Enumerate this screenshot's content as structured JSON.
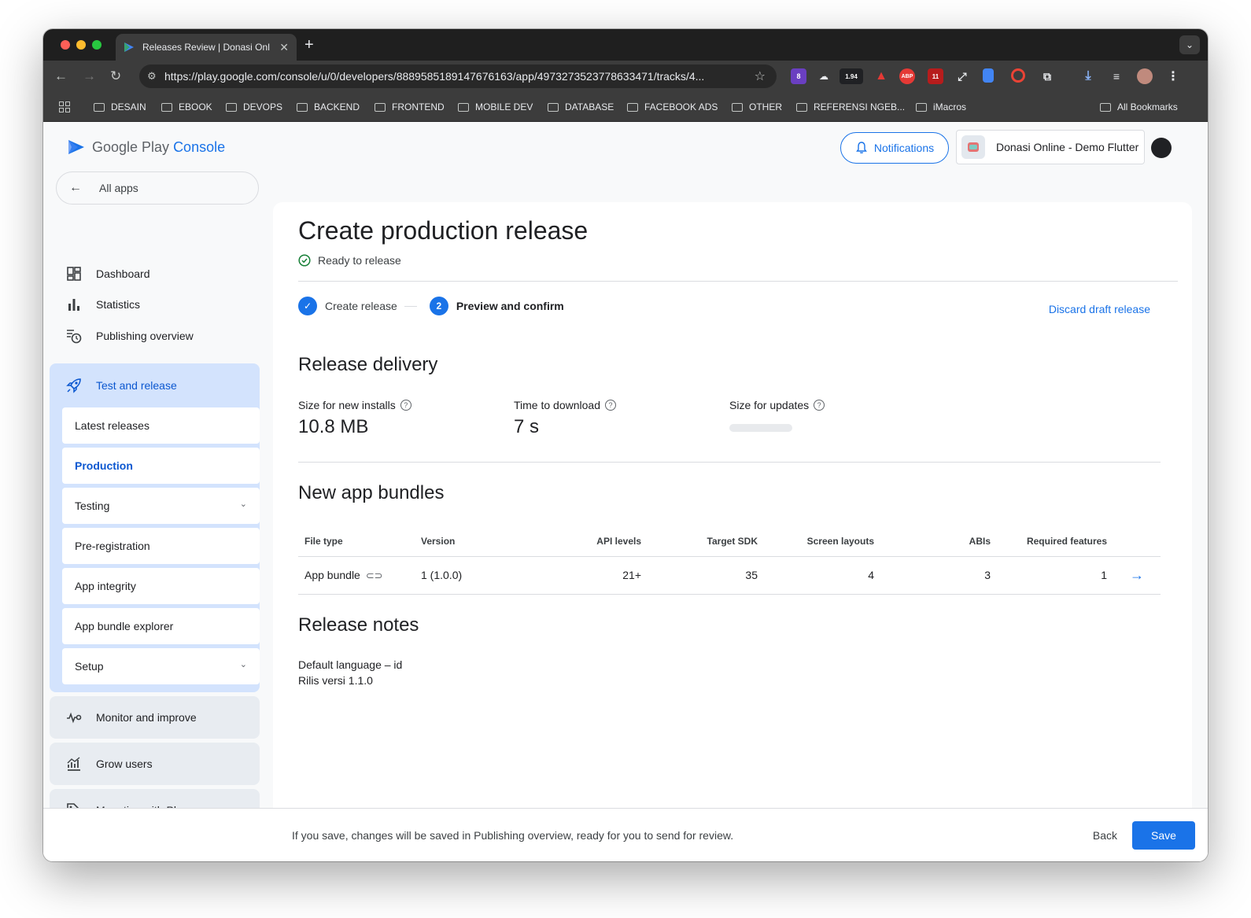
{
  "browser": {
    "tab_title": "Releases Review | Donasi Onl",
    "url": "https://play.google.com/console/u/0/developers/8889585189147676163/app/4973273523778633471/tracks/4...",
    "ext_badges": {
      "pink": "8",
      "speed": "1.94",
      "abp": "ABP",
      "red": "11"
    },
    "bookmarks": [
      "DESAIN",
      "EBOOK",
      "DEVOPS",
      "BACKEND",
      "FRONTEND",
      "MOBILE DEV",
      "DATABASE",
      "FACEBOOK ADS",
      "OTHER",
      "REFERENSI NGEB...",
      "iMacros"
    ],
    "all_bookmarks": "All Bookmarks"
  },
  "header": {
    "logo_google_play": "Google Play",
    "logo_console": "Console",
    "notifications": "Notifications",
    "app_name": "Donasi Online - Demo Flutter"
  },
  "sidebar": {
    "all_apps": "All apps",
    "dashboard": "Dashboard",
    "statistics": "Statistics",
    "publishing_overview": "Publishing overview",
    "test_and_release": "Test and release",
    "sub_items": [
      "Latest releases",
      "Production",
      "Testing",
      "Pre-registration",
      "App integrity",
      "App bundle explorer",
      "Setup"
    ],
    "monitor": "Monitor and improve",
    "grow": "Grow users",
    "monetise": "Monetise with Play"
  },
  "main": {
    "title": "Create production release",
    "status": "Ready to release",
    "steps": {
      "step1": "Create release",
      "step2_num": "2",
      "step2": "Preview and confirm"
    },
    "discard": "Discard draft release",
    "delivery": {
      "heading": "Release delivery",
      "size_label": "Size for new installs",
      "size_value": "10.8 MB",
      "time_label": "Time to download",
      "time_value": "7 s",
      "updates_label": "Size for updates"
    },
    "bundles": {
      "heading": "New app bundles",
      "columns": [
        "File type",
        "Version",
        "API levels",
        "Target SDK",
        "Screen layouts",
        "ABIs",
        "Required features"
      ],
      "row": {
        "file_type": "App bundle",
        "version": "1 (1.0.0)",
        "api": "21+",
        "target": "35",
        "screens": "4",
        "abis": "3",
        "features": "1"
      }
    },
    "notes": {
      "heading": "Release notes",
      "language": "Default language – id",
      "text": "Rilis versi 1.1.0"
    }
  },
  "footer": {
    "message": "If you save, changes will be saved in Publishing overview, ready for you to send for review.",
    "back": "Back",
    "save": "Save"
  }
}
